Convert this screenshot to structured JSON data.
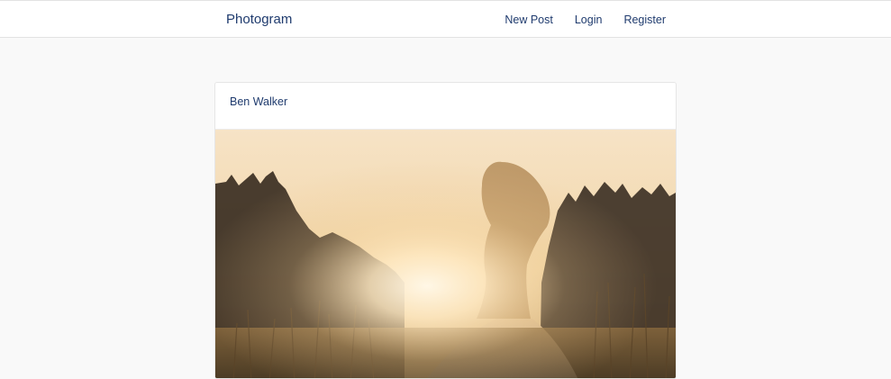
{
  "navbar": {
    "brand": "Photogram",
    "links": [
      {
        "label": "New Post"
      },
      {
        "label": "Login"
      },
      {
        "label": "Register"
      }
    ]
  },
  "post": {
    "author": "Ben Walker"
  },
  "colors": {
    "link": "#1f3b6e",
    "page_bg": "#f9f9f9",
    "card_bg": "#ffffff"
  }
}
